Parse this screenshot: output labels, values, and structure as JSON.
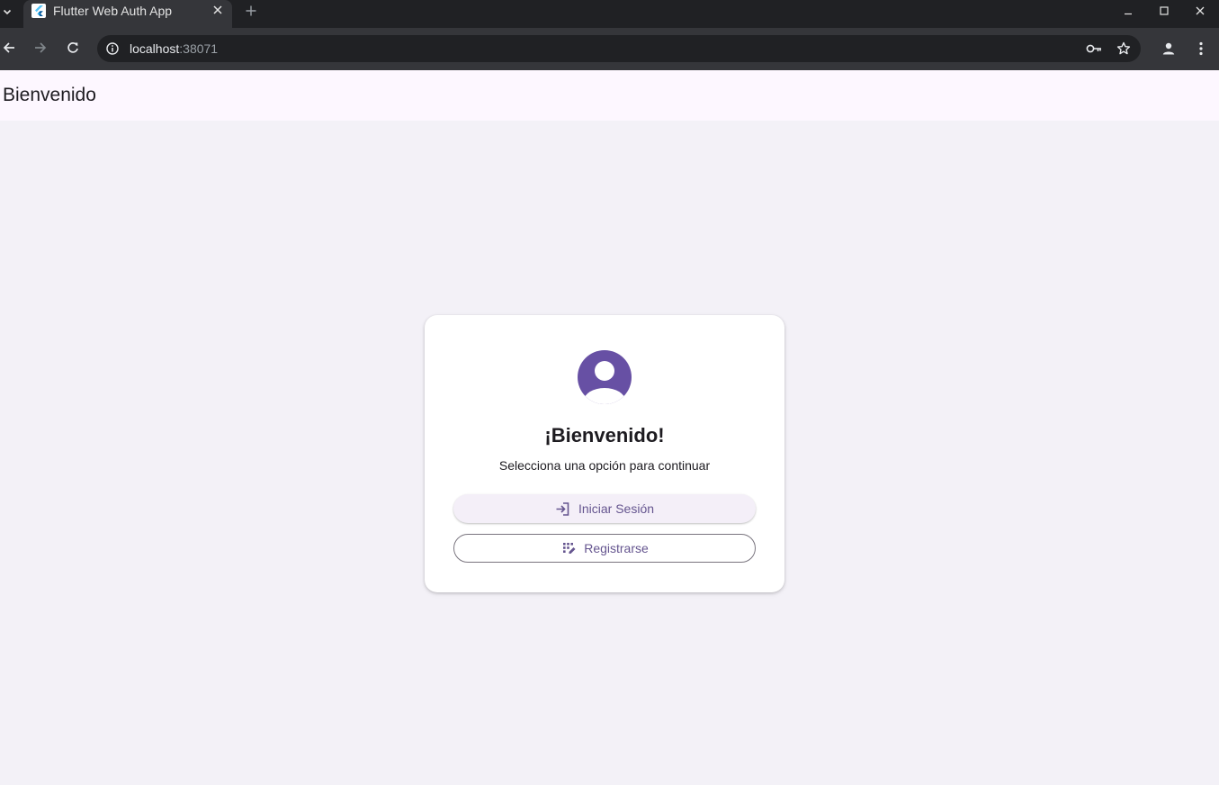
{
  "browser": {
    "tab_title": "Flutter Web Auth App",
    "url_host": "localhost",
    "url_port": ":38071"
  },
  "appbar": {
    "title": "Bienvenido"
  },
  "card": {
    "title": "¡Bienvenido!",
    "subtitle": "Selecciona una opción para continuar",
    "login_label": "Iniciar Sesión",
    "register_label": "Registrarse"
  },
  "colors": {
    "primary": "#65558f",
    "avatar": "#6750a4",
    "appbar_bg": "#fdf7ff",
    "page_bg": "#f3f1f7"
  },
  "icons": {
    "avatar": "account-circle-icon",
    "login": "login-icon",
    "register": "app-registration-icon"
  }
}
